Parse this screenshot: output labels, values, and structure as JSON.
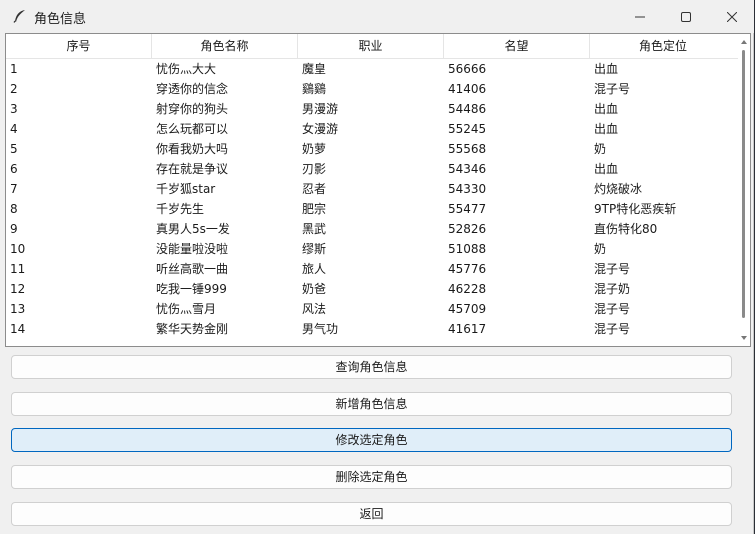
{
  "window": {
    "title": "角色信息",
    "icon": "feather-icon",
    "controls": [
      "minimize-icon",
      "maximize-icon",
      "close-icon"
    ]
  },
  "table": {
    "columns": [
      "序号",
      "角色名称",
      "职业",
      "名望",
      "角色定位"
    ],
    "rows": [
      [
        "1",
        "忧伤灬大大",
        "魔皇",
        "56666",
        "出血"
      ],
      [
        "2",
        "穿透你的信念",
        "鷄鷄",
        "41406",
        "混子号"
      ],
      [
        "3",
        "射穿你的狗头",
        "男漫游",
        "54486",
        "出血"
      ],
      [
        "4",
        "怎么玩都可以",
        "女漫游",
        "55245",
        "出血"
      ],
      [
        "5",
        "你看我奶大吗",
        "奶萝",
        "55568",
        "奶"
      ],
      [
        "6",
        "存在就是争议",
        "刃影",
        "54346",
        "出血"
      ],
      [
        "7",
        "千岁狐star",
        "忍者",
        "54330",
        "灼烧破冰"
      ],
      [
        "8",
        "千岁先生",
        "肥宗",
        "55477",
        "9TP特化恶疾斩"
      ],
      [
        "9",
        "真男人5s一发",
        "黑武",
        "52826",
        "直伤特化80"
      ],
      [
        "10",
        "没能量啦没啦",
        "缪斯",
        "51088",
        "奶"
      ],
      [
        "11",
        "听丝高歌一曲",
        "旅人",
        "45776",
        "混子号"
      ],
      [
        "12",
        "吃我一锤999",
        "奶爸",
        "46228",
        "混子奶"
      ],
      [
        "13",
        "忧伤灬雪月",
        "风法",
        "45709",
        "混子号"
      ],
      [
        "14",
        "繁华天势金刚",
        "男气功",
        "41617",
        "混子号"
      ]
    ]
  },
  "buttons": {
    "query": "查询角色信息",
    "add": "新增角色信息",
    "edit": "修改选定角色",
    "delete": "删除选定角色",
    "back": "返回"
  },
  "colors": {
    "window_bg": "#f0f0f0",
    "focus_border": "#0067c0",
    "focus_bg": "#e0eef9"
  }
}
